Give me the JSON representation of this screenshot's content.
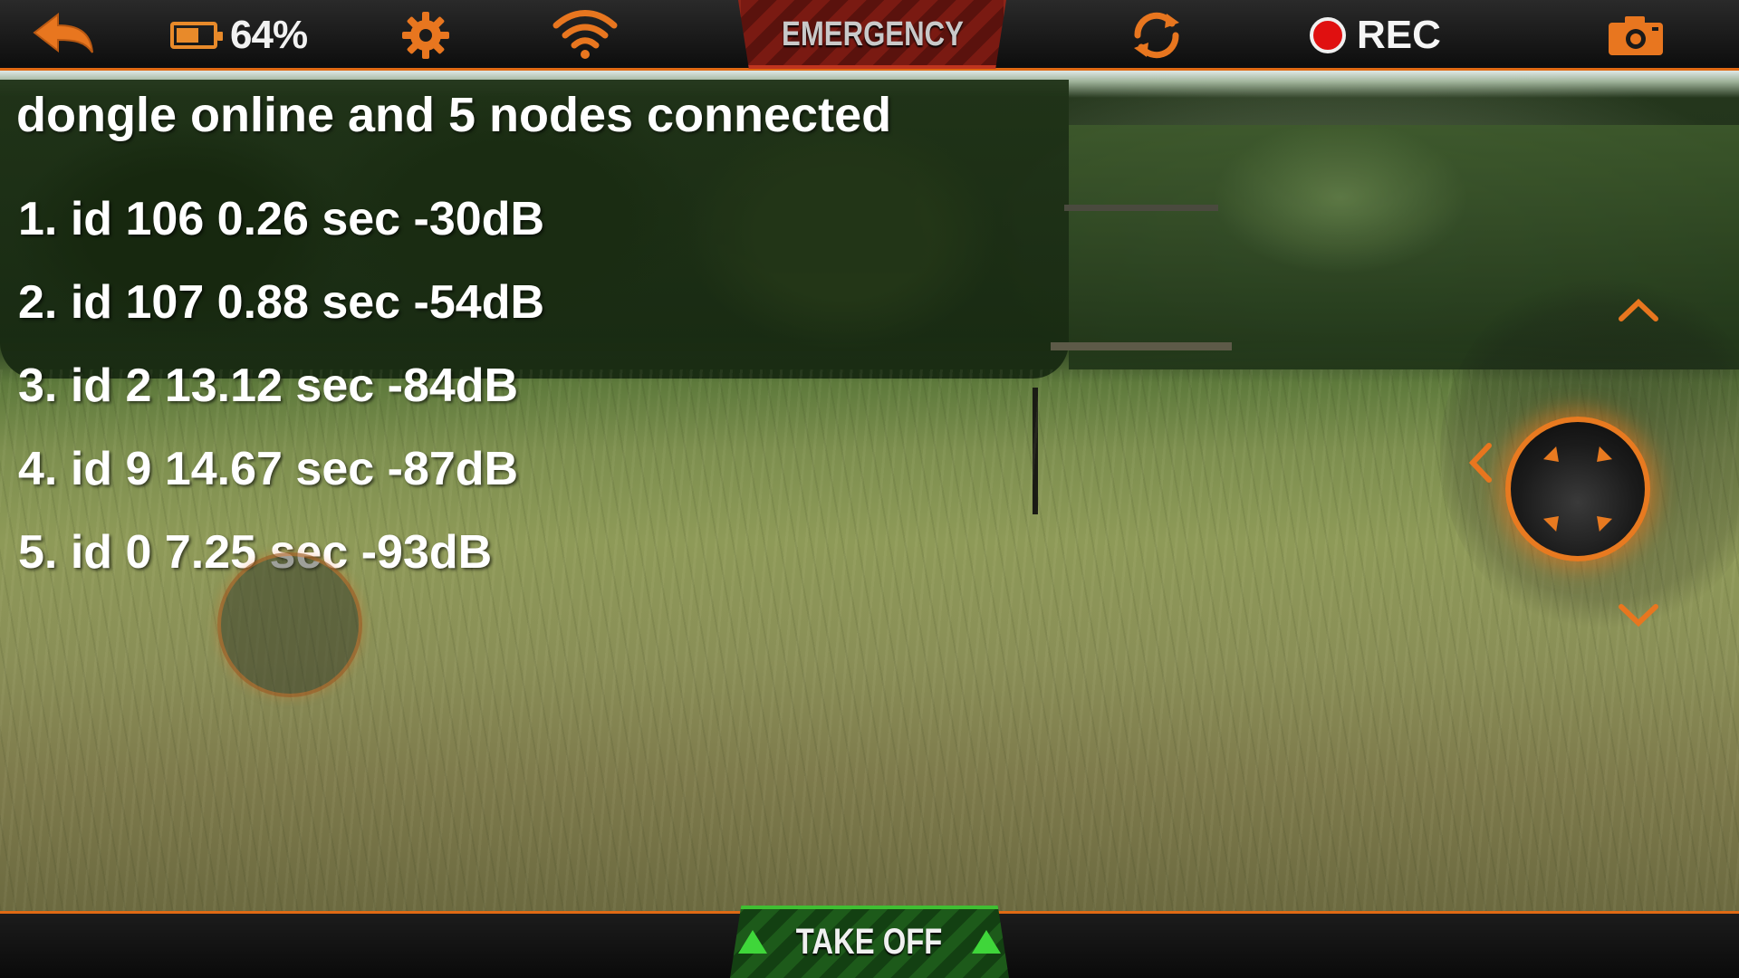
{
  "topbar": {
    "battery_percent": 0.64,
    "battery_label": "64%",
    "emergency_label": "EMERGENCY",
    "rec_label": "REC",
    "accent_color": "#e87a20"
  },
  "status": {
    "message": "dongle online and 5 nodes connected"
  },
  "nodes": [
    "1. id 106 0.26 sec -30dB",
    "2. id 107 0.88 sec -54dB",
    "3. id 2 13.12 sec -84dB",
    "4. id 9 14.67 sec -87dB",
    "5. id 0 7.25 sec -93dB"
  ],
  "bottombar": {
    "takeoff_label": "TAKE OFF",
    "takeoff_color": "#3fd63a"
  },
  "icons": {
    "back": "back-arrow-icon",
    "battery": "battery-icon",
    "settings": "gear-icon",
    "wifi": "wifi-icon",
    "flip": "rotate-camera-icon",
    "record": "record-dot-icon",
    "photo": "camera-icon"
  }
}
